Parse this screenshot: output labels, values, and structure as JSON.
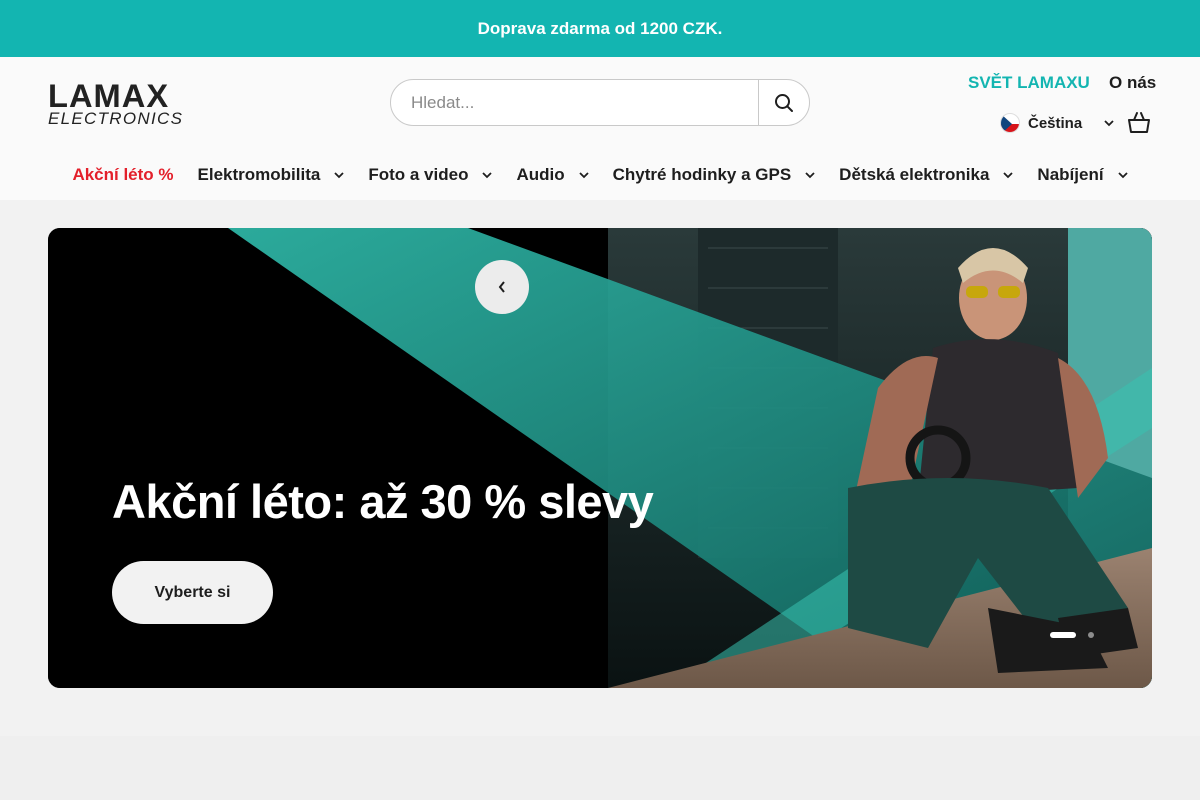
{
  "announcement": {
    "text": "Doprava zdarma od 1200 CZK."
  },
  "logo": {
    "line1": "LAMAX",
    "line2": "ELECTRONICS"
  },
  "search": {
    "placeholder": "Hledat..."
  },
  "header_links": {
    "world": "SVĚT LAMAXU",
    "about": "O nás"
  },
  "language": {
    "label": "Čeština"
  },
  "nav": {
    "items": [
      {
        "label": "Akční léto %"
      },
      {
        "label": "Elektromobilita"
      },
      {
        "label": "Foto a video"
      },
      {
        "label": "Audio"
      },
      {
        "label": "Chytré hodinky a GPS"
      },
      {
        "label": "Dětská elektronika"
      },
      {
        "label": "Nabíjení"
      }
    ]
  },
  "hero": {
    "title": "Akční léto: až 30 % slevy",
    "button": "Vyberte si",
    "slides_total": 2,
    "active_slide": 1
  },
  "colors": {
    "accent": "#13b5b1",
    "sale": "#e3202b",
    "text": "#1e1e1e"
  },
  "icons": {
    "search": "search-icon",
    "cart": "cart-icon",
    "chevron": "chevron-down-icon",
    "prev": "chevron-left-icon",
    "flag": "czech-flag-icon"
  }
}
